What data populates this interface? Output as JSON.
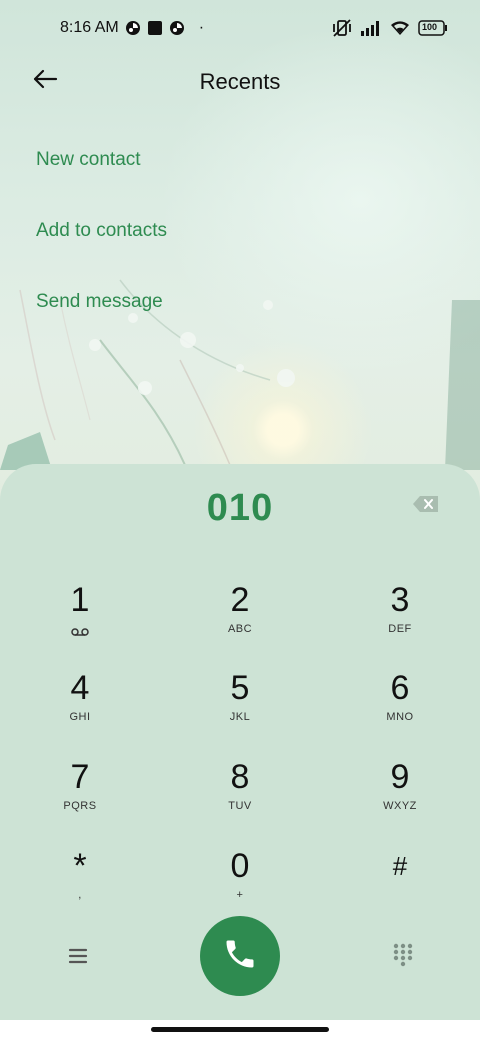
{
  "status_bar": {
    "time": "8:16 AM",
    "dot": "·",
    "battery": "100",
    "icons": [
      "app-notification-icon",
      "square-notification-icon",
      "app-notification-icon",
      "vibrate-off-icon",
      "signal-icon",
      "wifi-icon",
      "battery-icon"
    ]
  },
  "header": {
    "title": "Recents",
    "back_icon": "back-arrow-icon"
  },
  "actions": [
    {
      "label": "New contact"
    },
    {
      "label": "Add to contacts"
    },
    {
      "label": "Send message"
    }
  ],
  "dialer": {
    "number": "010",
    "backspace_icon": "backspace-icon",
    "keys": [
      {
        "digit": "1",
        "letters": "",
        "icon": "voicemail-icon"
      },
      {
        "digit": "2",
        "letters": "ABC"
      },
      {
        "digit": "3",
        "letters": "DEF"
      },
      {
        "digit": "4",
        "letters": "GHI"
      },
      {
        "digit": "5",
        "letters": "JKL"
      },
      {
        "digit": "6",
        "letters": "MNO"
      },
      {
        "digit": "7",
        "letters": "PQRS"
      },
      {
        "digit": "8",
        "letters": "TUV"
      },
      {
        "digit": "9",
        "letters": "WXYZ"
      },
      {
        "digit": "*",
        "letters": ","
      },
      {
        "digit": "0",
        "letters": "+"
      },
      {
        "digit": "#",
        "letters": ""
      }
    ]
  },
  "bottom": {
    "menu_icon": "menu-icon",
    "call_icon": "phone-icon",
    "dialpad_icon": "dialpad-icon"
  },
  "colors": {
    "accent": "#2e8b50",
    "panel": "#cde3d5",
    "background": "#d6e7dc"
  }
}
